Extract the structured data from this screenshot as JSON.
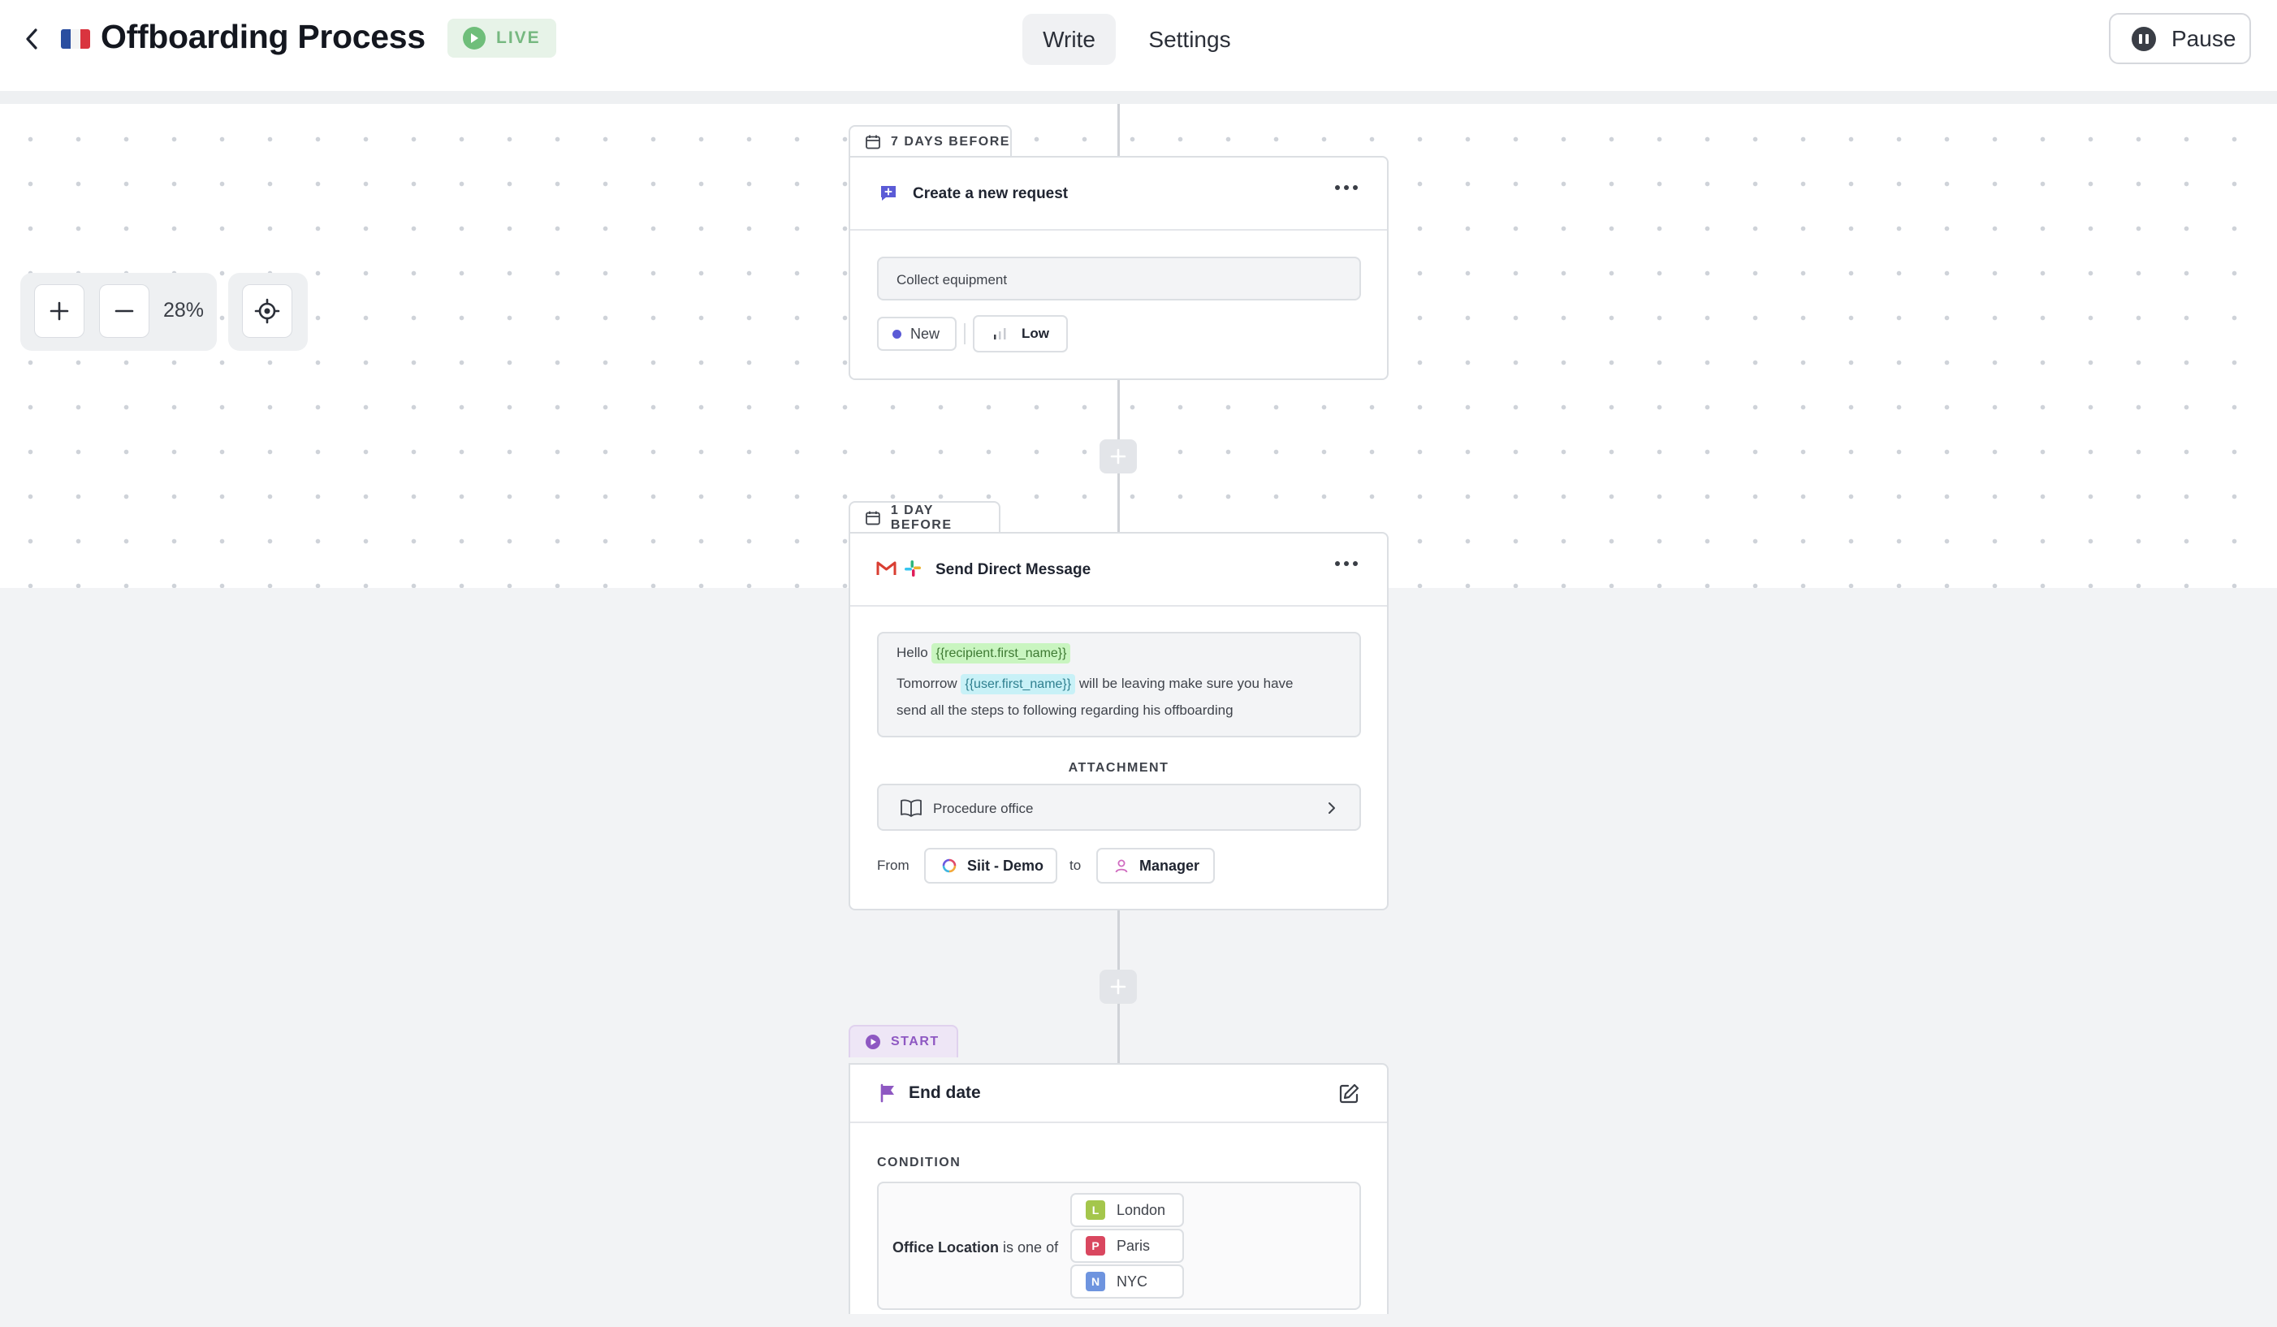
{
  "header": {
    "title": "Offboarding Process",
    "status": "LIVE",
    "tabs": [
      {
        "label": "Write",
        "active": true
      },
      {
        "label": "Settings",
        "active": false
      }
    ],
    "pause_label": "Pause"
  },
  "zoom": {
    "level": "28%"
  },
  "steps": [
    {
      "timing": "7 DAYS BEFORE",
      "title": "Create a new request",
      "request_title": "Collect equipment",
      "status": "New",
      "priority": "Low"
    },
    {
      "timing": "1 DAY BEFORE",
      "title": "Send Direct Message",
      "message": {
        "greeting": "Hello",
        "var_recipient": "{{recipient.first_name}}",
        "line2_prefix": "Tomorrow",
        "var_user": "{{user.first_name}}",
        "line2_suffix": "will be leaving make sure you have",
        "line3": "send all the steps to following regarding his offboarding"
      },
      "attachment_label": "ATTACHMENT",
      "attachment_name": "Procedure office",
      "from_label": "From",
      "from_value": "Siit - Demo",
      "to_label": "to",
      "to_value": "Manager"
    },
    {
      "timing": "START",
      "title": "End date",
      "condition_label": "CONDITION",
      "condition_field": "Office Location",
      "condition_operator": "is one of",
      "values": [
        {
          "letter": "L",
          "name": "London",
          "color": "#a4c64c"
        },
        {
          "letter": "P",
          "name": "Paris",
          "color": "#d9475f"
        },
        {
          "letter": "N",
          "name": "NYC",
          "color": "#6e94df"
        }
      ]
    }
  ],
  "colors": {
    "live_bg": "#e7f3e8",
    "live_fg": "#76b880",
    "request_icon": "#5b5bd6",
    "start_accent": "#8e58c2",
    "status_dot": "#5b5bd6"
  }
}
